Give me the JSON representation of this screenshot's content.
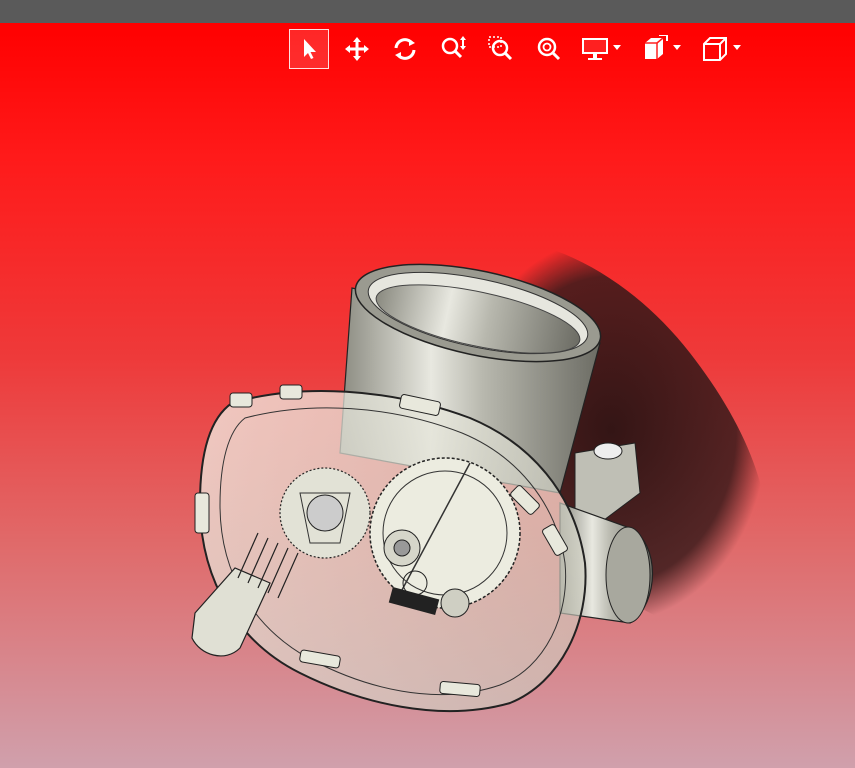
{
  "window": {
    "title": ""
  },
  "toolbar": {
    "tools": [
      {
        "name": "select-tool",
        "icon": "arrow-pointer-icon",
        "active": true
      },
      {
        "name": "pan-tool",
        "icon": "move-arrows-icon"
      },
      {
        "name": "rotate-tool",
        "icon": "rotate-icon"
      },
      {
        "name": "zoom-in-out-tool",
        "icon": "zoom-in-out-icon"
      },
      {
        "name": "zoom-window-tool",
        "icon": "zoom-window-icon"
      },
      {
        "name": "zoom-fit-tool",
        "icon": "zoom-fit-icon"
      },
      {
        "name": "display-mode-tool",
        "icon": "monitor-icon",
        "has_dropdown": true
      },
      {
        "name": "view-orientation-tool",
        "icon": "view-orientation-icon",
        "has_dropdown": true
      },
      {
        "name": "shaded-view-tool",
        "icon": "cube-icon",
        "has_dropdown": true
      }
    ]
  },
  "colors": {
    "titlebar": "#5a5a5a",
    "background_top": "#ff0000",
    "background_bottom": "#d0a0ac",
    "icon": "#ffffff"
  },
  "model": {
    "icon": "throttle-body-3d-model"
  }
}
